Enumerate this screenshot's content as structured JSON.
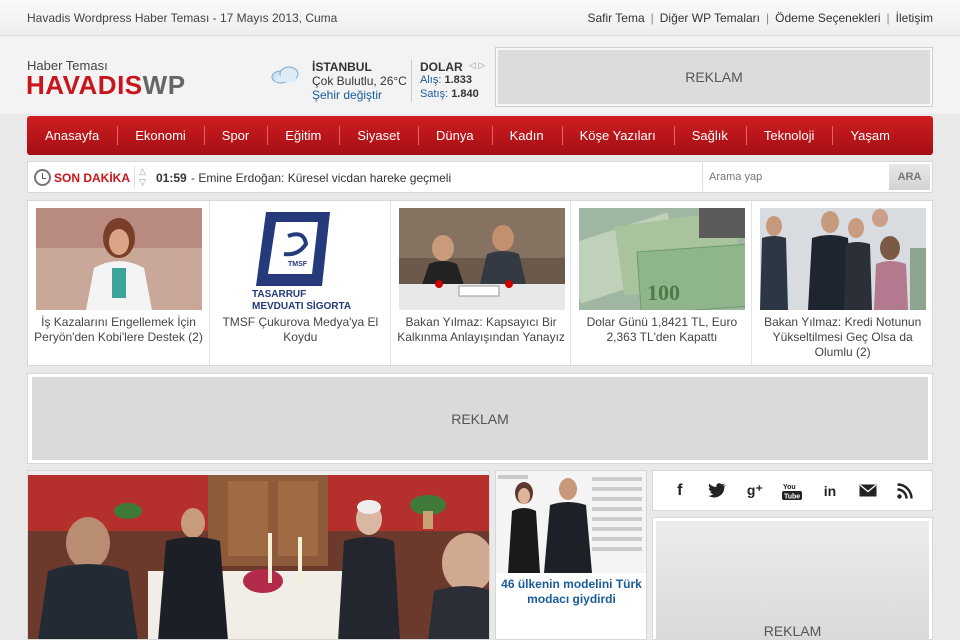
{
  "topbar": {
    "site_date": "Havadis Wordpress Haber Teması - 17 Mayıs 2013, Cuma",
    "links": [
      "Safir Tema",
      "Diğer WP Temaları",
      "Ödeme Seçenekleri",
      "İletişim"
    ]
  },
  "logo": {
    "subtitle": "Haber Teması",
    "brand_red": "HAVADIS",
    "brand_grey": "WP"
  },
  "weather": {
    "icon": "cloud-icon",
    "city": "İSTANBUL",
    "description": "Çok Bulutlu, 26°C",
    "change_link": "Şehir değiştir"
  },
  "currency": {
    "name": "DOLAR",
    "buy_label": "Alış:",
    "buy_value": "1.833",
    "sell_label": "Satış:",
    "sell_value": "1.840"
  },
  "ads": {
    "top": "REKLAM",
    "middle": "REKLAM",
    "side": "REKLAM"
  },
  "nav": {
    "items": [
      "Anasayfa",
      "Ekonomi",
      "Spor",
      "Eğitim",
      "Siyaset",
      "Dünya",
      "Kadın",
      "Köşe Yazıları",
      "Sağlık",
      "Teknoloji",
      "Yaşam"
    ]
  },
  "breaking": {
    "label": "SON DAKİKA",
    "time": "01:59",
    "text": "- Emine Erdoğan: Küresel vicdan hareke geçmeli"
  },
  "search": {
    "placeholder": "Arama yap",
    "button": "ARA"
  },
  "featured": [
    {
      "caption": "İş Kazalarını Engellemek İçin Peryön'den Kobi'lere Destek (2)"
    },
    {
      "caption": "TMSF Çukurova Medya'ya El Koydu",
      "logo_line1": "TASARRUF",
      "logo_line2": "MEVDUATI SİGORTA"
    },
    {
      "caption": "Bakan Yılmaz: Kapsayıcı Bir Kalkınma Anlayışından Yanayız"
    },
    {
      "caption": "Dolar Günü 1,8421 TL, Euro 2,363 TL'den Kapattı"
    },
    {
      "caption": "Bakan Yılmaz: Kredi Notunun Yükseltilmesi Geç Olsa da Olumlu (2)"
    }
  ],
  "side_story": {
    "caption": "46 ülkenin modelini Türk modacı giydirdi"
  },
  "social": [
    "facebook-icon",
    "twitter-icon",
    "google-plus-icon",
    "youtube-icon",
    "linkedin-icon",
    "email-icon",
    "rss-icon"
  ],
  "colors": {
    "brand_red": "#c8151b",
    "link_blue": "#1a5b9c"
  }
}
